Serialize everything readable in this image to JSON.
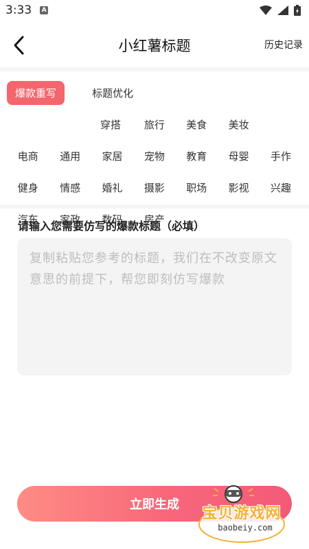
{
  "status": {
    "time": "3:33",
    "app_badge": "A"
  },
  "header": {
    "title": "小红薯标题",
    "history_label": "历史记录"
  },
  "tags": [
    {
      "label": "爆款重写",
      "active": true
    },
    {
      "label": "标题优化"
    },
    {
      "label": "穿搭"
    },
    {
      "label": "旅行"
    },
    {
      "label": "美食"
    },
    {
      "label": "美妆"
    },
    {
      "label": "电商"
    },
    {
      "label": "通用"
    },
    {
      "label": "家居"
    },
    {
      "label": "宠物"
    },
    {
      "label": "教育"
    },
    {
      "label": "母婴"
    },
    {
      "label": "手作"
    },
    {
      "label": "健身"
    },
    {
      "label": "情感"
    },
    {
      "label": "婚礼"
    },
    {
      "label": "摄影"
    },
    {
      "label": "职场"
    },
    {
      "label": "影视"
    },
    {
      "label": "兴趣"
    },
    {
      "label": "汽车"
    },
    {
      "label": "家政"
    },
    {
      "label": "数码"
    },
    {
      "label": "房产"
    }
  ],
  "input": {
    "label": "请输入您需要仿写的爆款标题（必填）",
    "placeholder": "复制粘贴您参考的标题，我们在不改变原文意思的前提下，帮您即刻仿写爆款",
    "value": ""
  },
  "generate_button": {
    "label": "立即生成"
  },
  "watermark": {
    "text": "宝贝游戏网",
    "url": "baobeiy.com"
  },
  "colors": {
    "accent": "#f4666d",
    "button_start": "#ff8c84",
    "button_end": "#f45a78",
    "input_bg": "#f4f4f4"
  }
}
